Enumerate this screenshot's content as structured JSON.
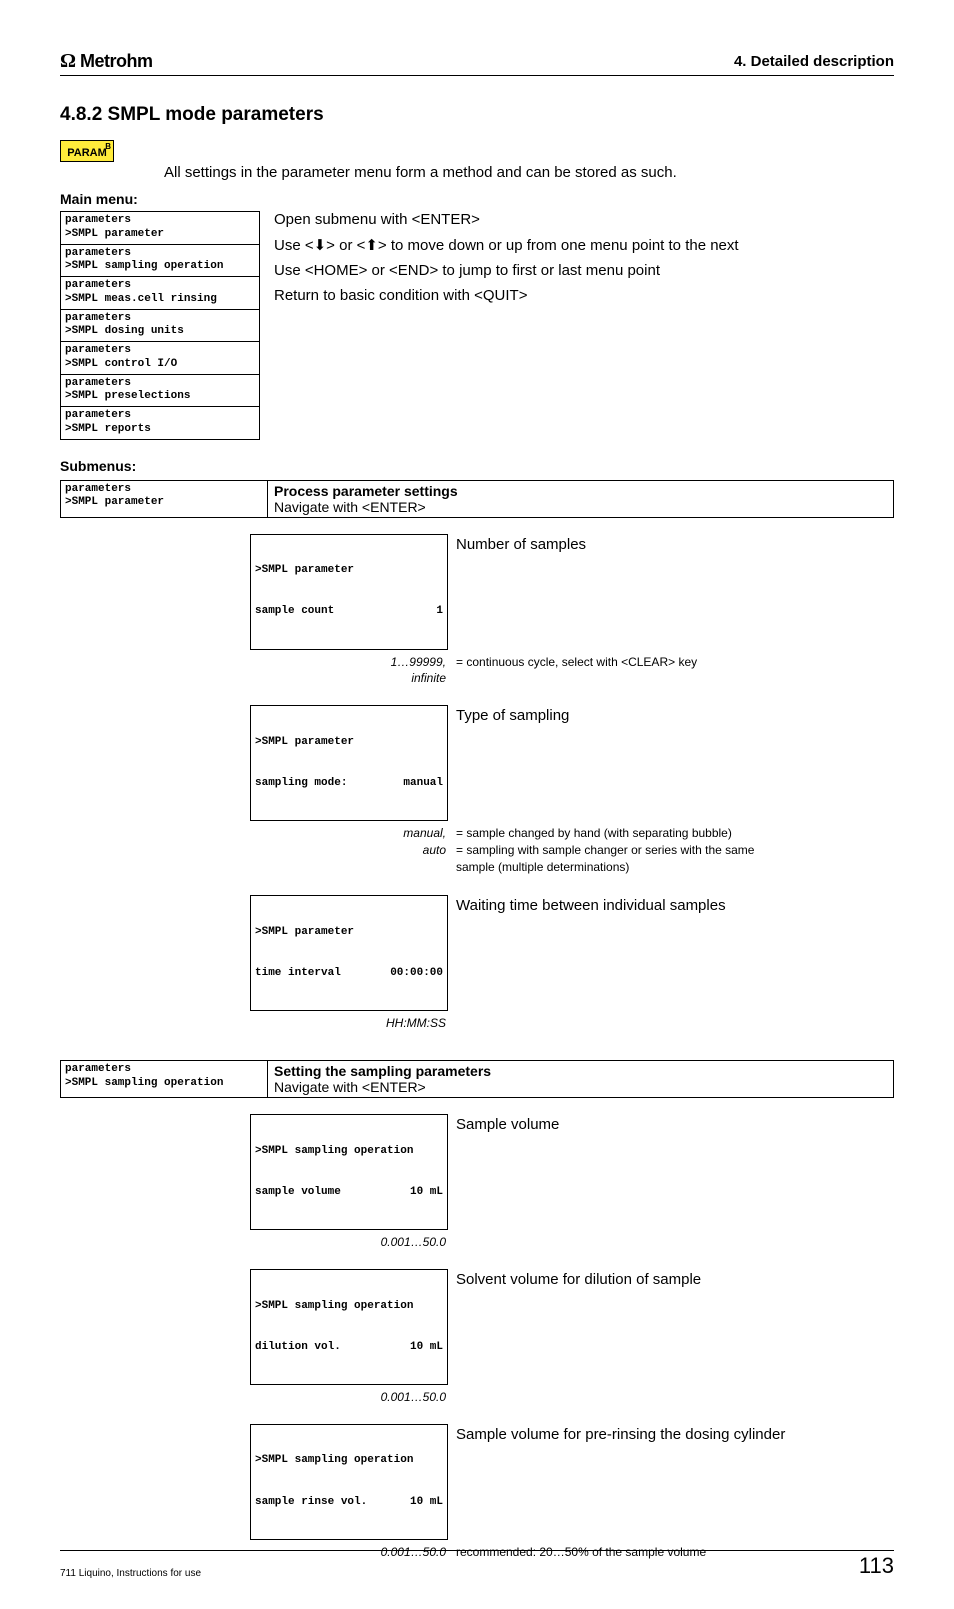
{
  "header": {
    "brand": "Metrohm",
    "section": "4. Detailed description"
  },
  "heading": "4.8.2  SMPL mode parameters",
  "param_key": {
    "b": "B",
    "label": "PARAM"
  },
  "intro": "All settings in the parameter menu form a method and can be stored as such.",
  "main_menu": {
    "label": "Main menu:",
    "items": [
      "parameters\n>SMPL parameter",
      "parameters\n>SMPL sampling operation",
      "parameters\n>SMPL meas.cell rinsing",
      "parameters\n>SMPL dosing units",
      "parameters\n>SMPL control I/O",
      "parameters\n>SMPL preselections",
      "parameters\n>SMPL reports"
    ],
    "info": {
      "l1": "Open submenu with <ENTER>",
      "l2": "Use <⬇> or <⬆> to move down or up from one menu point to the next",
      "l3": "Use <HOME> or <END> to jump to first or last menu point",
      "l4": "Return to basic condition with <QUIT>"
    }
  },
  "submenus_label": "Submenus:",
  "sm1": {
    "head_left": "parameters\n>SMPL parameter",
    "head_title": "Process parameter  settings",
    "head_nav": "Navigate with <ENTER>",
    "p1": {
      "line1": ">SMPL parameter",
      "line2_label": "sample count",
      "line2_val": "1",
      "desc": "Number of samples",
      "range": "1…99999,\ninfinite",
      "note": "=  continuous cycle, select with <CLEAR> key"
    },
    "p2": {
      "line1": ">SMPL parameter",
      "line2_label": "sampling mode:",
      "line2_val": "manual",
      "desc": "Type of sampling",
      "range": "manual,\nauto",
      "note": "=  sample changed by hand (with separating bubble)\n=  sampling with sample changer or series with the same\n    sample (multiple determinations)"
    },
    "p3": {
      "line1": ">SMPL parameter",
      "line2_label": "time interval",
      "line2_val": "00:00:00",
      "desc": "Waiting time between individual samples",
      "range": "HH:MM:SS",
      "note": ""
    }
  },
  "sm2": {
    "head_left": "parameters\n>SMPL sampling operation",
    "head_title": "Setting the sampling parameters",
    "head_nav": "Navigate with <ENTER>",
    "p1": {
      "line1": ">SMPL sampling operation",
      "line2_label": "sample volume",
      "line2_val": "10 mL",
      "desc": "Sample volume",
      "range": "0.001…50.0",
      "note": ""
    },
    "p2": {
      "line1": ">SMPL sampling operation",
      "line2_label": "dilution vol.",
      "line2_val": "10 mL",
      "desc": "Solvent volume for dilution of sample",
      "range": "0.001…50.0",
      "note": ""
    },
    "p3": {
      "line1": ">SMPL sampling operation",
      "line2_label": "sample rinse vol.",
      "line2_val": "10 mL",
      "desc": "Sample volume for pre-rinsing the dosing cylinder",
      "range": "0.001…50.0",
      "note": "recommended: 20…50% of the sample volume"
    }
  },
  "footer": {
    "left": "711 Liquino, Instructions for use",
    "page": "113"
  }
}
